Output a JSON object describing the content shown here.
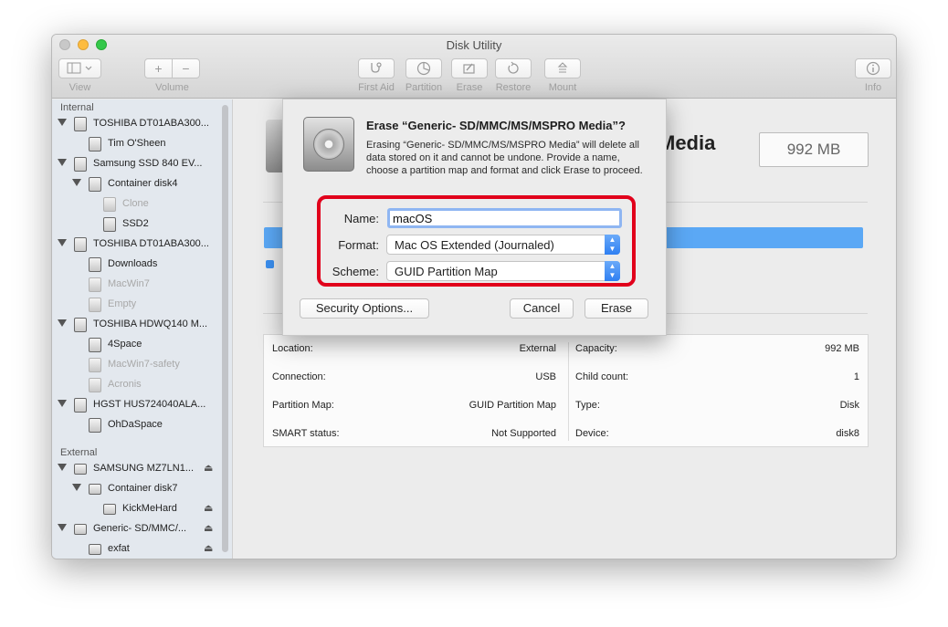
{
  "window": {
    "title": "Disk Utility"
  },
  "toolbar": {
    "view_label": "View",
    "volume_label": "Volume",
    "volume_add": "+",
    "volume_remove": "−",
    "first_aid_label": "First Aid",
    "partition_label": "Partition",
    "erase_label": "Erase",
    "restore_label": "Restore",
    "mount_label": "Mount",
    "info_label": "Info"
  },
  "sidebar": {
    "internal_header": "Internal",
    "external_header": "External",
    "items": [
      {
        "label": "TOSHIBA DT01ABA300...",
        "dim": false
      },
      {
        "label": "Tim O'Sheen",
        "dim": false
      },
      {
        "label": "Samsung SSD 840 EV...",
        "dim": false
      },
      {
        "label": "Container disk4",
        "dim": false
      },
      {
        "label": "Clone",
        "dim": true
      },
      {
        "label": "SSD2",
        "dim": false
      },
      {
        "label": "TOSHIBA DT01ABA300...",
        "dim": false
      },
      {
        "label": "Downloads",
        "dim": false
      },
      {
        "label": "MacWin7",
        "dim": true
      },
      {
        "label": "Empty",
        "dim": true
      },
      {
        "label": "TOSHIBA HDWQ140 M...",
        "dim": false
      },
      {
        "label": "4Space",
        "dim": false
      },
      {
        "label": "MacWin7-safety",
        "dim": true
      },
      {
        "label": "Acronis",
        "dim": true
      },
      {
        "label": "HGST HUS724040ALA...",
        "dim": false
      },
      {
        "label": "OhDaSpace",
        "dim": false
      },
      {
        "label": "SAMSUNG MZ7LN1...",
        "dim": false
      },
      {
        "label": "Container disk7",
        "dim": false
      },
      {
        "label": "KickMeHard",
        "dim": false
      },
      {
        "label": "Generic- SD/MMC/...",
        "dim": false
      },
      {
        "label": "exfat",
        "dim": false
      }
    ]
  },
  "main": {
    "title_fragment": "Media",
    "capacity_box": "992 MB",
    "info": {
      "location_key": "Location:",
      "location_val": "External",
      "connection_key": "Connection:",
      "connection_val": "USB",
      "partition_map_key": "Partition Map:",
      "partition_map_val": "GUID Partition Map",
      "smart_key": "SMART status:",
      "smart_val": "Not Supported",
      "capacity_key": "Capacity:",
      "capacity_val": "992 MB",
      "child_count_key": "Child count:",
      "child_count_val": "1",
      "type_key": "Type:",
      "type_val": "Disk",
      "device_key": "Device:",
      "device_val": "disk8"
    }
  },
  "sheet": {
    "title": "Erase “Generic- SD/MMC/MS/MSPRO Media”?",
    "message": "Erasing “Generic- SD/MMC/MS/MSPRO Media” will delete all data stored on it and cannot be undone. Provide a name, choose a partition map and format and click Erase to proceed.",
    "name_label": "Name:",
    "name_value": "macOS",
    "format_label": "Format:",
    "format_value": "Mac OS Extended (Journaled)",
    "scheme_label": "Scheme:",
    "scheme_value": "GUID Partition Map",
    "security_button": "Security Options...",
    "cancel_button": "Cancel",
    "erase_button": "Erase"
  },
  "colors": {
    "accent": "#3b8fef",
    "highlight_red": "#e1001b",
    "bar_blue": "#5ba8f5"
  }
}
